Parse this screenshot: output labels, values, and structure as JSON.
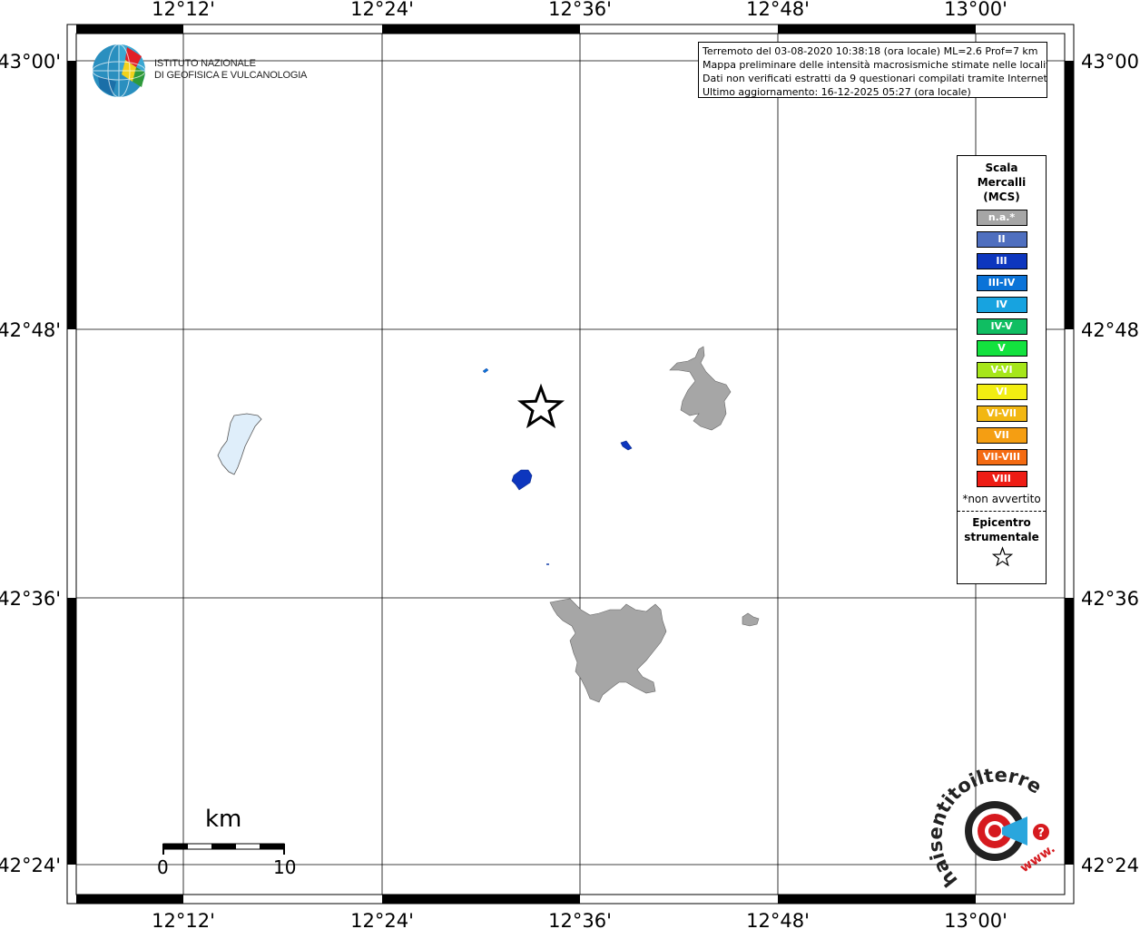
{
  "map": {
    "lon_ticks": [
      "12°12'",
      "12°24'",
      "12°36'",
      "12°48'",
      "13°00'"
    ],
    "lat_ticks": [
      "43°00'",
      "42°48'",
      "42°36'",
      "42°24'"
    ]
  },
  "header": {
    "line1": "Terremoto del 03-08-2020 10:38:18 (ora locale) ML=2.6 Prof=7 km",
    "line2": "Mappa preliminare delle intensità macrosismiche stimate nelle località",
    "line3": "Dati non verificati estratti da 9 questionari compilati tramite Internet.",
    "line4": "Ultimo aggiornamento: 16-12-2025 05:27 (ora locale)"
  },
  "logo": {
    "line1": "ISTITUTO NAZIONALE",
    "line2": "DI GEOFISICA E VULCANOLOGIA"
  },
  "legend": {
    "title": "Scala Mercalli (MCS)",
    "items": [
      {
        "label": "n.a.*",
        "color": "#a6a6a6"
      },
      {
        "label": "II",
        "color": "#4f6fbf"
      },
      {
        "label": "III",
        "color": "#0d36be"
      },
      {
        "label": "III-IV",
        "color": "#0a73d8"
      },
      {
        "label": "IV",
        "color": "#17a3e0"
      },
      {
        "label": "IV-V",
        "color": "#10be62"
      },
      {
        "label": "V",
        "color": "#13e23e"
      },
      {
        "label": "V-VI",
        "color": "#a6e61a"
      },
      {
        "label": "VI",
        "color": "#f2ee12"
      },
      {
        "label": "VI-VII",
        "color": "#f2b712"
      },
      {
        "label": "VII",
        "color": "#f59e12"
      },
      {
        "label": "VII-VIII",
        "color": "#f46b12"
      },
      {
        "label": "VIII",
        "color": "#ee1c14"
      }
    ],
    "note": "*non avvertito",
    "epicenter_label": "Epicentro strumentale"
  },
  "scale_bar": {
    "unit": "km",
    "min_label": "0",
    "max_label": "10"
  },
  "watermark": {
    "text": "haisentitoilterremoto.it",
    "url_text": "www."
  }
}
